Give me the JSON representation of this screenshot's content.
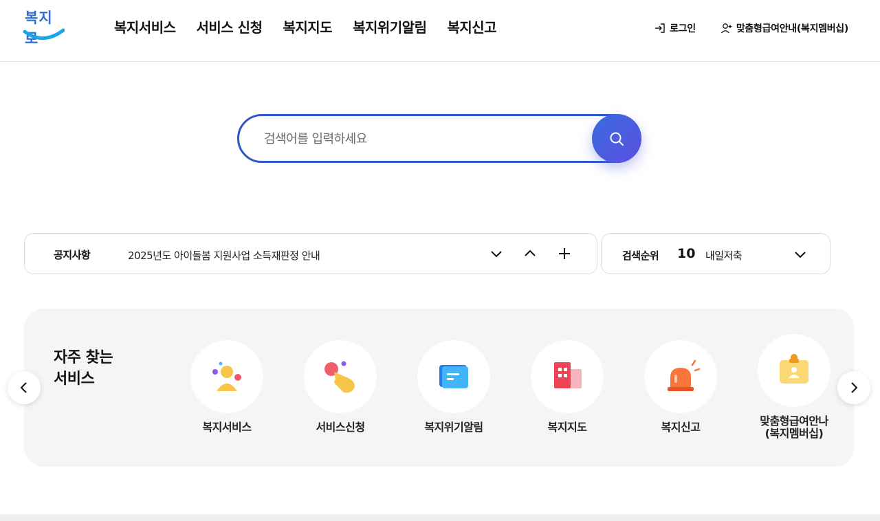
{
  "header": {
    "logo_text": "복지로",
    "nav": [
      "복지서비스",
      "서비스 신청",
      "복지지도",
      "복지위기알림",
      "복지신고"
    ],
    "login_label": "로그인",
    "membership_label": "맞춤형급여안내(복지멤버십)"
  },
  "search": {
    "placeholder": "검색어를 입력하세요"
  },
  "notice": {
    "label": "공지사항",
    "text": "2025년도 아이돌봄 지원사업 소득재판정 안내"
  },
  "rank": {
    "label": "검색순위",
    "number": "10",
    "keyword": "내일저축"
  },
  "frequent": {
    "title_line1": "자주 찾는",
    "title_line2": "서비스",
    "items": [
      {
        "label": "복지서비스",
        "icon": "people-icon"
      },
      {
        "label": "서비스신청",
        "icon": "hand-tap-icon"
      },
      {
        "label": "복지위기알림",
        "icon": "message-icon"
      },
      {
        "label": "복지지도",
        "icon": "building-icon"
      },
      {
        "label": "복지신고",
        "icon": "siren-icon"
      },
      {
        "label": "맞춤형급여안나",
        "label2": "(복지멤버십)",
        "icon": "id-badge-icon"
      }
    ]
  },
  "colors": {
    "accent_blue": "#2e57c9",
    "search_button": "#4f5ce0",
    "panel_bg": "#f5f5f5"
  }
}
